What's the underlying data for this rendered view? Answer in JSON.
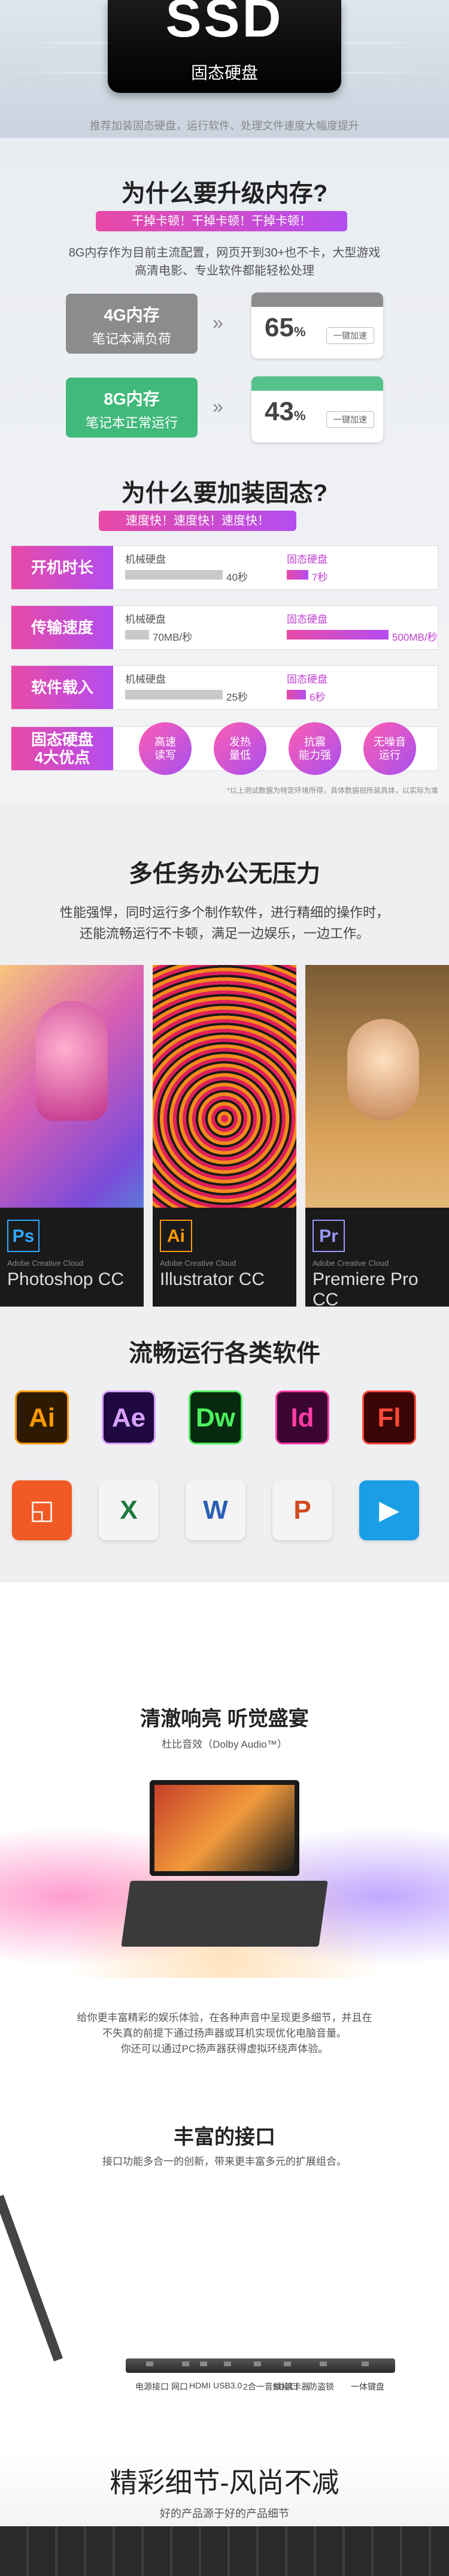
{
  "hero": {
    "title": "SSD",
    "subtitle": "固态硬盘",
    "tagline": "推荐加装固态硬盘，运行软件、处理文件速度大幅度提升"
  },
  "memory": {
    "heading": "为什么要升级内存?",
    "badge": "干掉卡顿！干掉卡顿！干掉卡顿！",
    "desc_line1": "8G内存作为目前主流配置，网页开到30+也不卡，大型游戏",
    "desc_line2": "高清电影、专业软件都能轻松处理",
    "card4": {
      "title": "4G内存",
      "note": "笔记本满负荷",
      "percent": "65",
      "unit": "%",
      "btn": "一键加速",
      "color": "#8c8c8c"
    },
    "card8": {
      "title": "8G内存",
      "note": "笔记本正常运行",
      "percent": "43",
      "unit": "%",
      "btn": "一键加速",
      "color": "#41b97b"
    }
  },
  "ssd": {
    "heading": "为什么要加装固态?",
    "badge": "速度快！速度快！速度快！",
    "rows": [
      {
        "label": "开机时长",
        "hdd_name": "机械硬盘",
        "hdd_value": "40秒",
        "hdd_fraction": 0.65,
        "ssd_name": "固态硬盘",
        "ssd_value": "7秒",
        "ssd_fraction": 0.18
      },
      {
        "label": "传输速度",
        "hdd_name": "机械硬盘",
        "hdd_value": "70MB/秒",
        "hdd_fraction": 0.16,
        "ssd_name": "固态硬盘",
        "ssd_value": "500MB/秒",
        "ssd_fraction": 0.85
      },
      {
        "label": "软件载入",
        "hdd_name": "机械硬盘",
        "hdd_value": "25秒",
        "hdd_fraction": 0.65,
        "ssd_name": "固态硬盘",
        "ssd_value": "6秒",
        "ssd_fraction": 0.16
      }
    ],
    "advantages_label_1": "固态硬盘",
    "advantages_label_2": "4大优点",
    "advantages": [
      {
        "l1": "高速",
        "l2": "读写"
      },
      {
        "l1": "发热",
        "l2": "量低"
      },
      {
        "l1": "抗震",
        "l2": "能力强"
      },
      {
        "l1": "无噪音",
        "l2": "运行"
      }
    ],
    "footnote": "*以上测试数据为特定环境所得，具体数据视所装具体，以实际为准"
  },
  "office": {
    "heading": "多任务办公无压力",
    "desc_line1": "性能强悍，同时运行多个制作软件，进行精细的操作时，",
    "desc_line2": "还能流畅运行不卡顿，满足一边娱乐，一边工作。",
    "apps": [
      {
        "abbr": "Ps",
        "suite": "Adobe Creative Cloud",
        "name": "Photoshop CC",
        "color": "#31a8ff"
      },
      {
        "abbr": "Ai",
        "suite": "Adobe Creative Cloud",
        "name": "Illustrator CC",
        "color": "#ff9a00"
      },
      {
        "abbr": "Pr",
        "suite": "Adobe Creative Cloud",
        "name": "Premiere Pro CC",
        "color": "#9999ff"
      }
    ]
  },
  "software": {
    "heading": "流畅运行各类软件",
    "row1": [
      {
        "abbr": "Ai",
        "bg": "#2e1a00",
        "fg": "#ff9a00"
      },
      {
        "abbr": "Ae",
        "bg": "#1f0740",
        "fg": "#d8a1ff"
      },
      {
        "abbr": "Dw",
        "bg": "#072a0e",
        "fg": "#4cf05e"
      },
      {
        "abbr": "Id",
        "bg": "#3a0530",
        "fg": "#ff3da8"
      },
      {
        "abbr": "Fl",
        "bg": "#3a0505",
        "fg": "#ff4a3a"
      }
    ],
    "row2": [
      {
        "abbr": "◱",
        "bg": "#f15a24",
        "fg": "#ffffff"
      },
      {
        "abbr": "X",
        "bg": "#f4f4f4",
        "fg": "#1d7a3f"
      },
      {
        "abbr": "W",
        "bg": "#f4f4f4",
        "fg": "#2b5fb4"
      },
      {
        "abbr": "P",
        "bg": "#f4f4f4",
        "fg": "#d04a20"
      },
      {
        "abbr": "▶",
        "bg": "#1a9ee6",
        "fg": "#ffffff"
      }
    ]
  },
  "audio": {
    "heading": "清澈响亮 听觉盛宴",
    "sub": "杜比音效（Dolby Audio™）",
    "desc_line1": "给你更丰富精彩的娱乐体验，在各种声音中呈现更多细节，并且在",
    "desc_line2": "不失真的前提下通过扬声器或耳机实现优化电脑音量。",
    "desc_line3": "你还可以通过PC扬声器获得虚拟环绕声体验。"
  },
  "ports": {
    "heading": "丰富的接口",
    "sub": "接口功能多合一的创新，带来更丰富多元的扩展组合。",
    "labels": [
      "电源接口",
      "网口",
      "HDMI",
      "USB3.0",
      "2合一音频接口",
      "SD读卡器",
      "防盗锁",
      "一体键盘"
    ]
  },
  "details": {
    "heading": "精彩细节-风尚不减",
    "sub": "好的产品源于好的产品细节"
  }
}
